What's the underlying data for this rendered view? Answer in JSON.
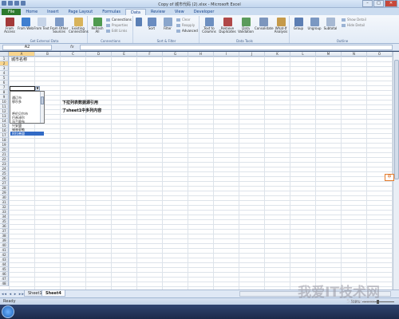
{
  "window": {
    "title": "Copy of 城市代码 (2).xlsx - Microsoft Excel",
    "buttons": [
      "–",
      "□",
      "✕"
    ]
  },
  "ribbon_tabs": [
    "File",
    "Home",
    "Insert",
    "Page Layout",
    "Formulas",
    "Data",
    "Review",
    "View",
    "Developer"
  ],
  "active_tab": "Data",
  "ribbon": {
    "get_external": {
      "label": "Get External Data",
      "buttons": [
        "From Access",
        "From Web",
        "From Text",
        "From Other Sources",
        "Existing Connections"
      ]
    },
    "connections": {
      "label": "Connections",
      "refresh": "Refresh All",
      "items": [
        "Connections",
        "Properties",
        "Edit Links"
      ]
    },
    "sort_filter": {
      "label": "Sort & Filter",
      "sort": "Sort",
      "filter": "Filter",
      "items": [
        "Clear",
        "Reapply",
        "Advanced"
      ]
    },
    "data_tools": {
      "label": "Data Tools",
      "buttons": [
        "Text to Columns",
        "Remove Duplicates",
        "Data Validation",
        "Consolidate",
        "What-If Analysis"
      ]
    },
    "outline": {
      "label": "Outline",
      "buttons": [
        "Group",
        "Ungroup",
        "Subtotal"
      ],
      "items": [
        "Show Detail",
        "Hide Detail"
      ]
    }
  },
  "formula_bar": {
    "name_box": "A2",
    "fx": "fx",
    "value": ""
  },
  "columns": [
    "A",
    "B",
    "C",
    "D",
    "E",
    "F",
    "G",
    "H",
    "I",
    "J",
    "K",
    "L",
    "M",
    "N",
    "O"
  ],
  "rows": [
    "1",
    "2",
    "3",
    "4",
    "5",
    "6",
    "7",
    "8",
    "9",
    "10",
    "11",
    "12",
    "13",
    "14",
    "15",
    "16",
    "17",
    "18",
    "19",
    "20",
    "21",
    "22",
    "23",
    "24",
    "25",
    "26",
    "27",
    "28",
    "29",
    "30",
    "31",
    "32",
    "33",
    "34",
    "35",
    "36",
    "37",
    "38",
    "39",
    "40",
    "41",
    "42",
    "43",
    "44",
    "45",
    "46",
    "47",
    "48"
  ],
  "cells": {
    "a1": "城市名称"
  },
  "dropdown": {
    "items": [
      "",
      "通辽市",
      "鄂尔多",
      "",
      "",
      "呼伦贝尔市",
      "巴彦淖尔",
      "乌兰察布",
      "兴安盟",
      "锡林郭勒",
      "阿拉善盟"
    ],
    "selected_index": 10
  },
  "note": {
    "line1": "下拉列表数据源引用",
    "line2": "了sheet1中多列内容"
  },
  "sheet_tabs": [
    "Sheet1",
    "Sheet4"
  ],
  "active_sheet": "Sheet4",
  "status": {
    "ready": "Ready",
    "zoom": "100%"
  },
  "watermark": {
    "brand": "我爱IT技术网",
    "url": "52itw.com"
  },
  "side_badge": "中"
}
